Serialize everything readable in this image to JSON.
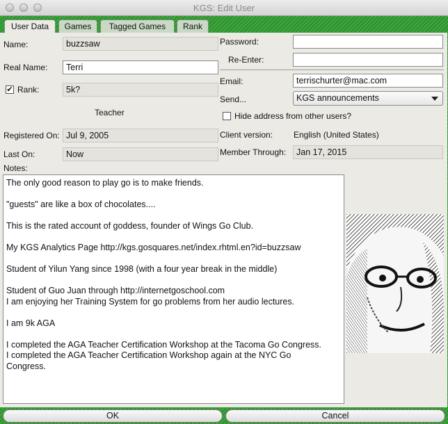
{
  "window": {
    "title": "KGS: Edit User"
  },
  "tabs": [
    {
      "label": "User Data"
    },
    {
      "label": "Games"
    },
    {
      "label": "Tagged Games"
    },
    {
      "label": "Rank"
    }
  ],
  "user": {
    "name_label": "Name:",
    "name_value": "buzzsaw",
    "real_name_label": "Real Name:",
    "real_name_value": "Terri",
    "rank_check": "✔",
    "rank_label": "Rank:",
    "rank_value": "5k?",
    "teacher_label": "Teacher",
    "registered_label": "Registered On:",
    "registered_value": "Jul 9, 2005",
    "last_on_label": "Last On:",
    "last_on_value": "Now",
    "notes_label": "Notes:"
  },
  "account": {
    "password_label": "Password:",
    "reenter_label": "Re-Enter:",
    "email_label": "Email:",
    "email_value": "terrischurter@mac.com",
    "send_label": "Send...",
    "send_value": "KGS announcements",
    "hide_label": "Hide address from other users?",
    "client_label": "Client version:",
    "client_value": "English (United States)",
    "member_label": "Member Through:",
    "member_value": "Jan 17, 2015"
  },
  "notes_lines": [
    "The only good reason to play go is to make friends.",
    "",
    "\"guests\" are like a box of chocolates....",
    "",
    "This is the rated account of goddess, founder of Wings Go Club.",
    "",
    "My KGS Analytics Page  http://kgs.gosquares.net/index.rhtml.en?id=buzzsaw",
    "",
    "Student of Yilun Yang since 1998 (with a four year break in the middle)",
    "",
    "Student of Guo Juan through http://internetgoschool.com",
    "I am enjoying her Training System for go problems from her audio lectures.",
    "",
    "I am 9k AGA",
    "",
    "I completed the AGA Teacher Certification Workshop at the Tacoma Go Congress.",
    "I completed the AGA Teacher Certification Workshop again at the NYC Go",
    "Congress."
  ],
  "buttons": {
    "ok": "OK",
    "cancel": "Cancel"
  }
}
